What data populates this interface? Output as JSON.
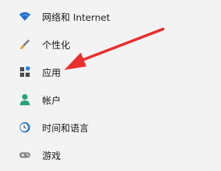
{
  "settings_nav": {
    "items": [
      {
        "label": "网络和 Internet",
        "icon": "wifi-icon"
      },
      {
        "label": "个性化",
        "icon": "paintbrush-icon"
      },
      {
        "label": "应用",
        "icon": "apps-icon"
      },
      {
        "label": "帐户",
        "icon": "person-icon"
      },
      {
        "label": "时间和语言",
        "icon": "clock-globe-icon"
      },
      {
        "label": "游戏",
        "icon": "gamepad-icon"
      }
    ]
  },
  "annotation": {
    "arrow_color": "#e8302f",
    "points_to": "apps"
  },
  "colors": {
    "background": "#f3f3f3",
    "wifi_blue": "#1f6fd1",
    "account_green": "#2aa37a",
    "text": "#1a1a1a"
  }
}
